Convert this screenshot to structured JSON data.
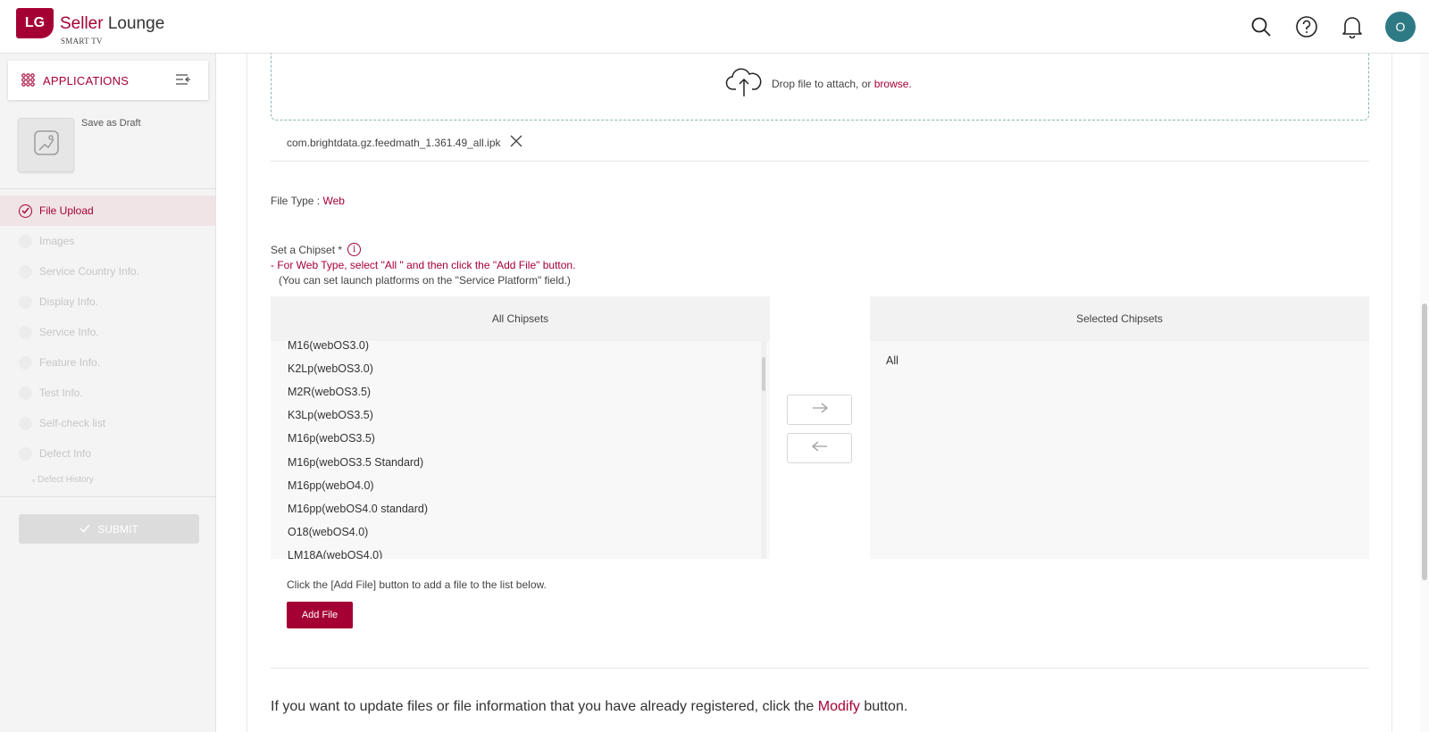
{
  "header": {
    "logo_text": "LG",
    "brand_primary": "Seller",
    "brand_secondary": "Lounge",
    "brand_sub": "SMART TV",
    "avatar_initial": "O",
    "accent_color": "#a50034"
  },
  "sidebar": {
    "apps_label": "APPLICATIONS",
    "save_draft": "Save as Draft",
    "nav": [
      {
        "label": "File Upload",
        "active": true
      },
      {
        "label": "Images"
      },
      {
        "label": "Service Country Info."
      },
      {
        "label": "Display Info."
      },
      {
        "label": "Service Info."
      },
      {
        "label": "Feature Info."
      },
      {
        "label": "Test Info."
      },
      {
        "label": "Self-check list"
      },
      {
        "label": "Defect Info"
      }
    ],
    "sub_item": "Defect History",
    "submit_label": "SUBMIT"
  },
  "upload": {
    "drop_text": "Drop file to attach, or",
    "browse_text": "browse.",
    "file_name": "com.brightdata.gz.feedmath_1.361.49_all.ipk"
  },
  "file_type": {
    "label": "File Type :",
    "value": "Web"
  },
  "chipset": {
    "label": "Set a Chipset *",
    "hint_line1": "- For Web Type, select \"All \" and then click the \"Add File\" button.",
    "hint_line2": "(You can set launch platforms on the \"Service Platform\" field.)",
    "all_header": "All Chipsets",
    "selected_header": "Selected Chipsets",
    "all_items": [
      "M16(webOS3.0)",
      "K2Lp(webOS3.0)",
      "M2R(webOS3.5)",
      "K3Lp(webOS3.5)",
      "M16p(webOS3.5)",
      "M16p(webOS3.5 Standard)",
      "M16pp(webO4.0)",
      "M16pp(webOS4.0 standard)",
      "O18(webOS4.0)",
      "LM18A(webOS4.0)"
    ],
    "selected_items": [
      "All"
    ]
  },
  "add_file": {
    "hint": "Click the [Add File] button to add a file to the list below.",
    "button_label": "Add File"
  },
  "bottom": {
    "text_before": "If you want to update files or file information that you have already registered, click the",
    "modify": "Modify",
    "text_after": "button."
  }
}
